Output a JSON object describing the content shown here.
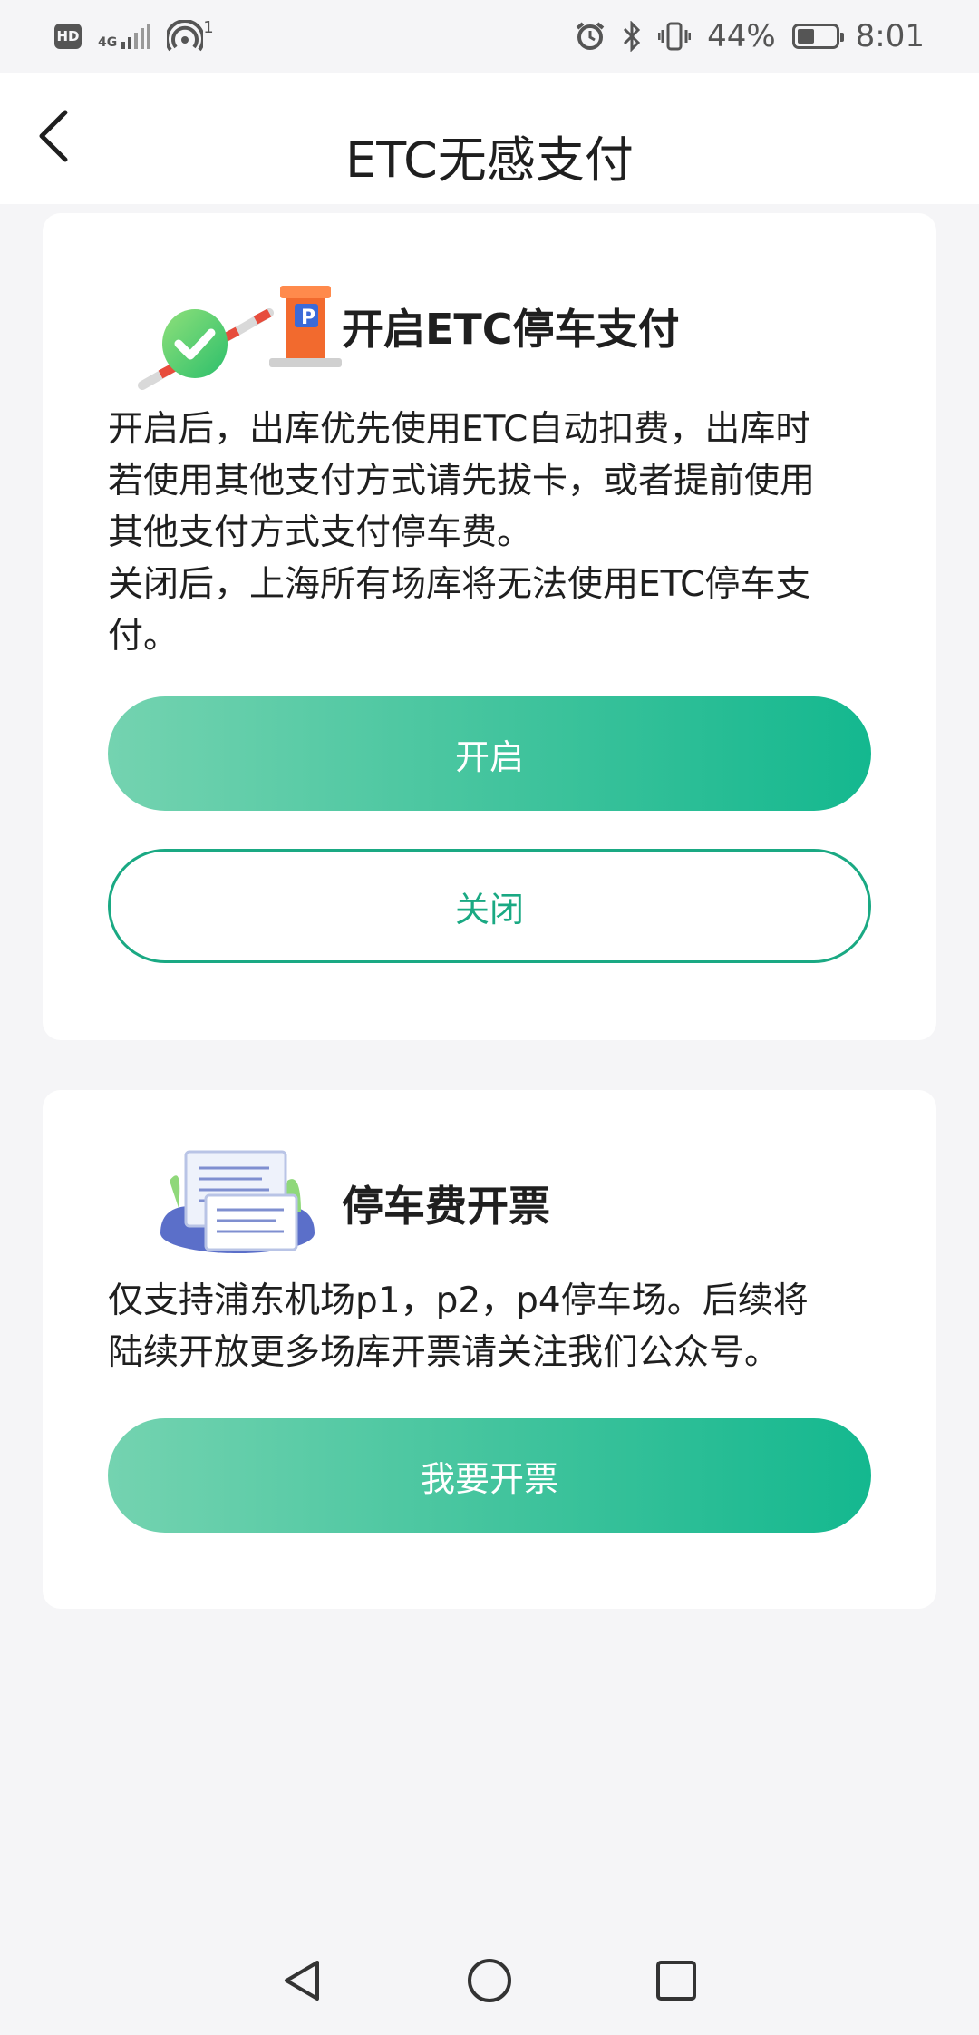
{
  "status_bar": {
    "hd": "HD",
    "network": "4G",
    "wifi_badge": "1",
    "battery_percent": "44%",
    "battery_level": 0.44,
    "time": "8:01"
  },
  "header": {
    "title": "ETC无感支付",
    "back_icon": "chevron-left-icon"
  },
  "etc_card": {
    "title": "开启ETC停车支付",
    "desc_lines": [
      "开启后，出库优先使用ETC自动扣费，出库时",
      "若使用其他支付方式请先拔卡，或者提前使用",
      "其他支付方式支付停车费。",
      "关闭后，上海所有场库将无法使用ETC停车支",
      "付。"
    ],
    "enable_label": "开启",
    "disable_label": "关闭",
    "icon": "parking-gate-icon"
  },
  "invoice_card": {
    "title": "停车费开票",
    "desc_lines": [
      "仅支持浦东机场p1，p2，p4停车场。后续将",
      "陆续开放更多场库开票请关注我们公众号。"
    ],
    "invoice_label": "我要开票",
    "icon": "invoice-icon"
  },
  "colors": {
    "accent": "#1aa983",
    "gradient_start": "#74d3b0",
    "gradient_end": "#14b88f",
    "page_bg": "#f5f5f7"
  }
}
